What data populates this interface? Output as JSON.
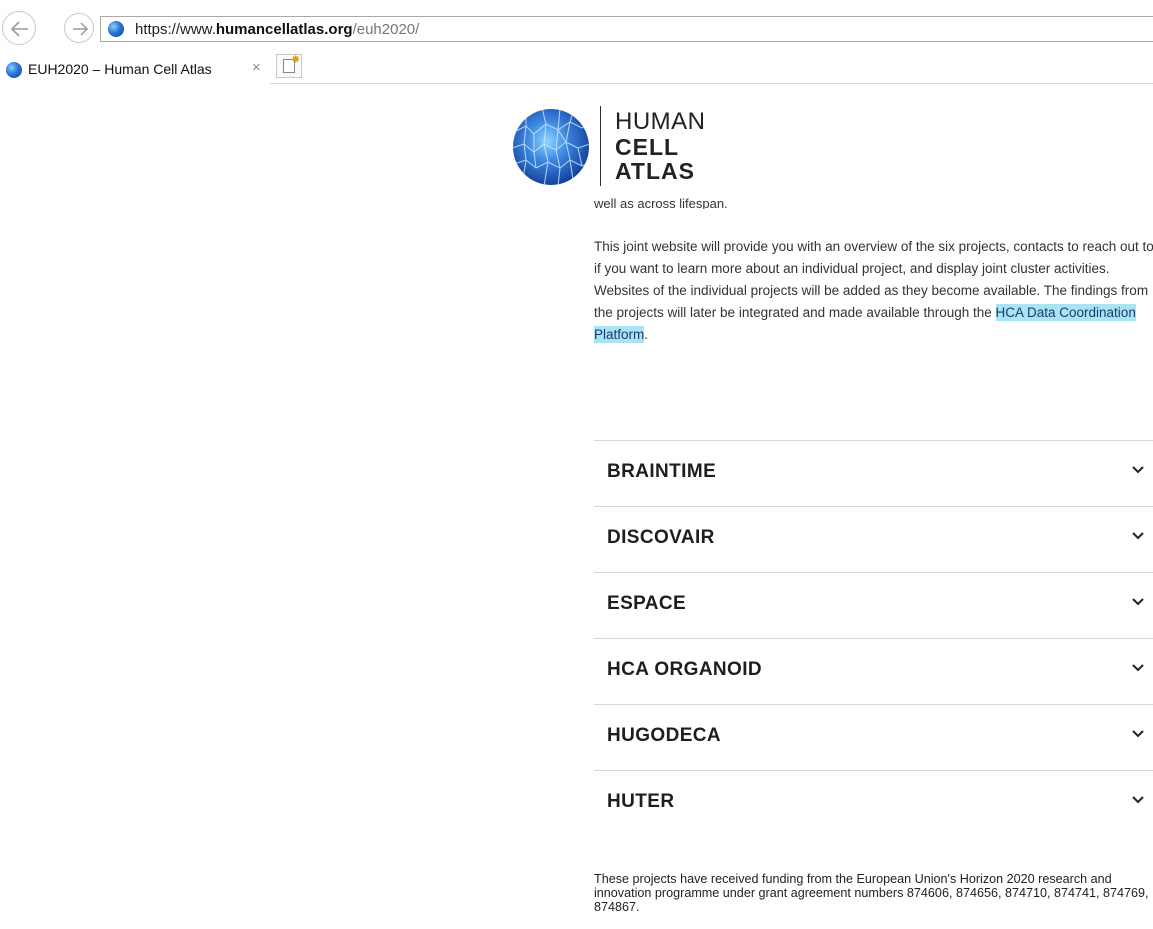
{
  "browser": {
    "url_protocol": "https://www.",
    "url_host": "humancellatlas.org",
    "url_path": "/euh2020/",
    "tab_title": "EUH2020 – Human Cell Atlas",
    "tab_close": "×"
  },
  "logo": {
    "line1": "HUMAN",
    "line2": "CELL",
    "line3": "ATLAS"
  },
  "content": {
    "cut_line": "well as across lifespan.",
    "intro_text": "This joint website will provide you with an overview of the six projects, contacts to reach out to if you want to learn more about an individual project, and display joint cluster activities. Websites of the individual projects will be added as they become available. The findings from the projects will later be integrated and made available through the ",
    "intro_link": "HCA Data Coordination Platform",
    "intro_end": ".",
    "projects": [
      "BRAINTIME",
      "DISCOVAIR",
      "ESPACE",
      "HCA ORGANOID",
      "HUGODECA",
      "HUTER"
    ],
    "funding": "These projects have received funding from the European Union's Horizon 2020 research and innovation programme under grant agreement numbers 874606, 874656, 874710, 874741, 874769, 874867."
  },
  "colors": {
    "link_highlight": "#a8e4f4",
    "heading": "#1e1e1e",
    "divider": "#d8d8d8",
    "logo_blue": "#2a74d6"
  }
}
